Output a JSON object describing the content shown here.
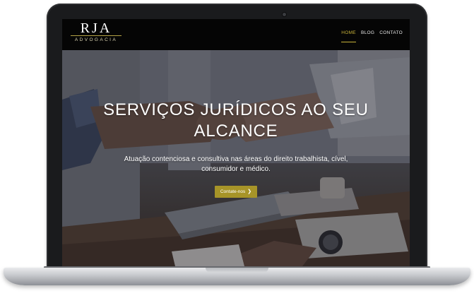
{
  "site": {
    "logo_mark": "RJA",
    "logo_sub": "ADVOGACIA"
  },
  "nav": {
    "items": [
      {
        "label": "HOME",
        "active": true
      },
      {
        "label": "BLOG",
        "active": false
      },
      {
        "label": "CONTATO",
        "active": false
      }
    ]
  },
  "hero": {
    "title": "SERVIÇOS JURÍDICOS AO SEU ALCANCE",
    "subtitle": "Atuação contenciosa e consultiva nas áreas do direito trabalhista, cível, consumidor e médico.",
    "cta_label": "Contate-nos",
    "cta_icon": "chevron-right-icon"
  },
  "colors": {
    "accent": "#a79428",
    "nav_active": "#c9b43a",
    "header_bg": "#050505"
  },
  "device": {
    "type": "laptop-mockup"
  }
}
